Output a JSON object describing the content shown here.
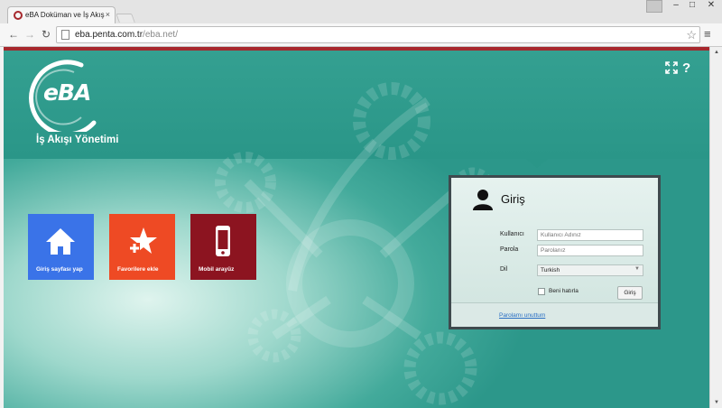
{
  "browser": {
    "tab_title": "eBA Doküman ve İş Akışı Y",
    "tab_close": "×",
    "url_host": "eba.penta.com.tr",
    "url_path": "/eba.net/",
    "win_min": "‒",
    "win_max": "□",
    "win_close": "✕"
  },
  "header": {
    "logo": "eBA",
    "app_title": "İş Akışı Yönetimi",
    "help": "?"
  },
  "tiles": [
    {
      "label": "Giriş sayfası yap",
      "icon": "home-icon"
    },
    {
      "label": "Favorilere ekle",
      "icon": "star-plus-icon"
    },
    {
      "label": "Mobil arayüz",
      "icon": "mobile-phone-icon"
    }
  ],
  "login": {
    "title": "Giriş",
    "username_label": "Kullanıcı",
    "username_placeholder": "Kullanıcı Adınız",
    "password_label": "Parola",
    "password_placeholder": "Parolanız",
    "language_label": "Dil",
    "language_value": "Turkish",
    "remember_label": "Beni hatırla",
    "submit_label": "Giriş",
    "forgot_label": "Parolamı unuttum"
  },
  "colors": {
    "accent_red": "#a6282d",
    "teal": "#2a9688",
    "tile_home": "#3a73e8",
    "tile_fav": "#ee4a24",
    "tile_mobile": "#8c1420"
  }
}
